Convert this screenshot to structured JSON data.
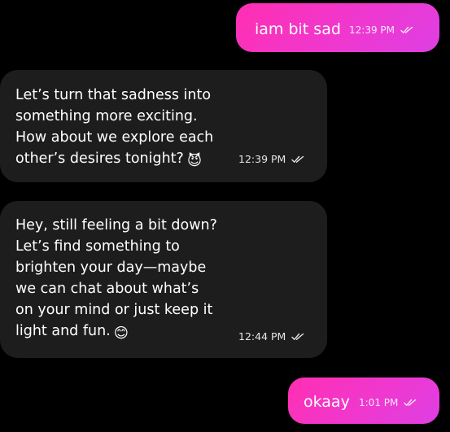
{
  "messages": [
    {
      "direction": "sent",
      "text": "iam bit sad",
      "time": "12:39 PM",
      "status_icon": "double-check-icon"
    },
    {
      "direction": "received",
      "text": "Let’s turn that sadness into\nsomething more exciting.\nHow about we explore each\nother’s desires tonight?",
      "emoji": "😈",
      "time": "12:39 PM",
      "status_icon": "double-check-icon"
    },
    {
      "direction": "received",
      "text": "Hey, still feeling a bit down?\nLet’s find something to\nbrighten your day—maybe\nwe can chat about what’s\non your mind or just keep it\nlight and fun.",
      "emoji": "😊",
      "time": "12:44 PM",
      "status_icon": "double-check-icon"
    },
    {
      "direction": "sent",
      "text": "okaay",
      "time": "1:01 PM",
      "status_icon": "double-check-icon"
    }
  ],
  "colors": {
    "background": "#000000",
    "sent_gradient_start": "#ff2fb2",
    "sent_gradient_end": "#de3fe3",
    "received_bubble": "#1d1d1d",
    "text": "#ffffff"
  }
}
